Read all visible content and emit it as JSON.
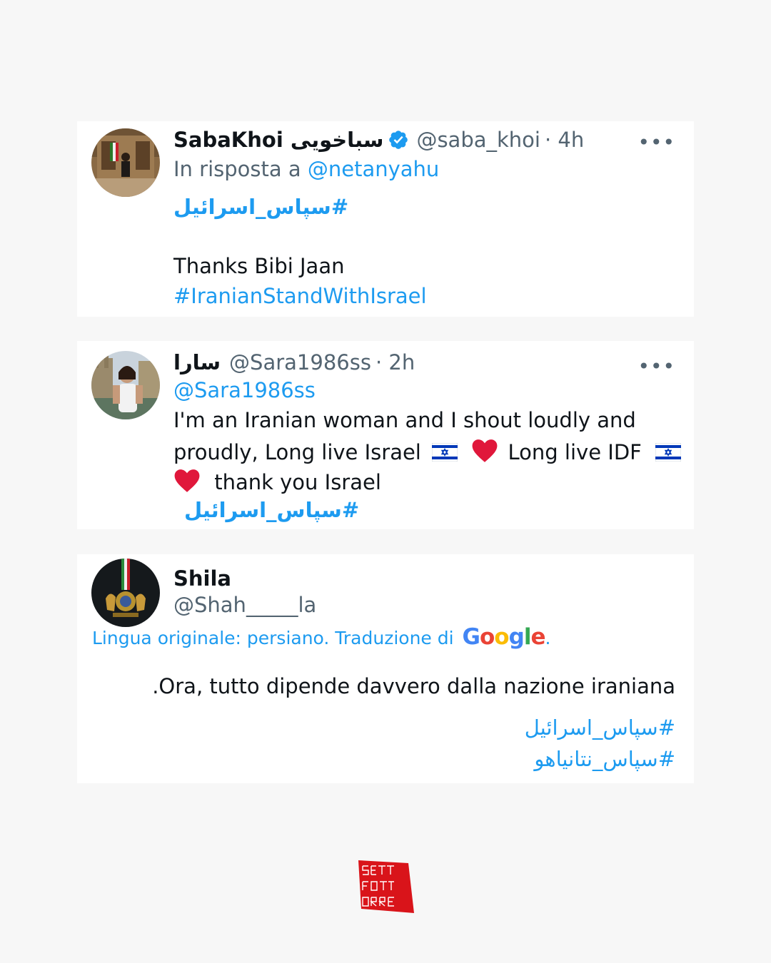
{
  "tweets": [
    {
      "name": "SabaKhoi سباخویی",
      "handle": "@saba_khoi",
      "time": "· 4h",
      "reply_prefix": "In risposta a",
      "reply_to": "@netanyahu",
      "hashtag_fa": "#سپاس_اسرائیل",
      "text": "Thanks Bibi Jaan",
      "hashtag_en": "#IranianStandWithIsrael",
      "more": "•••"
    },
    {
      "name": "سارا",
      "handle": "@Sara1986ss",
      "time": "· 2h",
      "mention": "@Sara1986ss",
      "line1": "I'm an Iranian woman and I shout loudly and",
      "line2a": "proudly, Long live Israel",
      "line2b": "Long live IDF",
      "line3": "thank you Israel",
      "hashtag_fa": "#سپاس_اسرائیل",
      "more": "•••"
    },
    {
      "name": "Shila",
      "handle": "@Shah_____la",
      "translation_note": "Lingua originale: persiano. Traduzione di",
      "google": "Google",
      "google_dot": ".",
      "text": ".Ora, tutto dipende davvero dalla nazione iraniana",
      "hashtag1": "#سپاس_اسرائیل",
      "hashtag2": "#سپاس_نتانیاهو"
    }
  ],
  "colors": {
    "background": "#f7f7f7",
    "card": "#ffffff",
    "link": "#1d9bf0",
    "secondary": "#536471",
    "verified": "#1d9bf0",
    "heart": "#e0173b",
    "logo": "#d9141a"
  },
  "icons": [
    "verified-badge-icon",
    "more-options-icon",
    "israel-flag-icon",
    "red-heart-icon",
    "google-logo-icon",
    "publisher-logo-icon"
  ]
}
